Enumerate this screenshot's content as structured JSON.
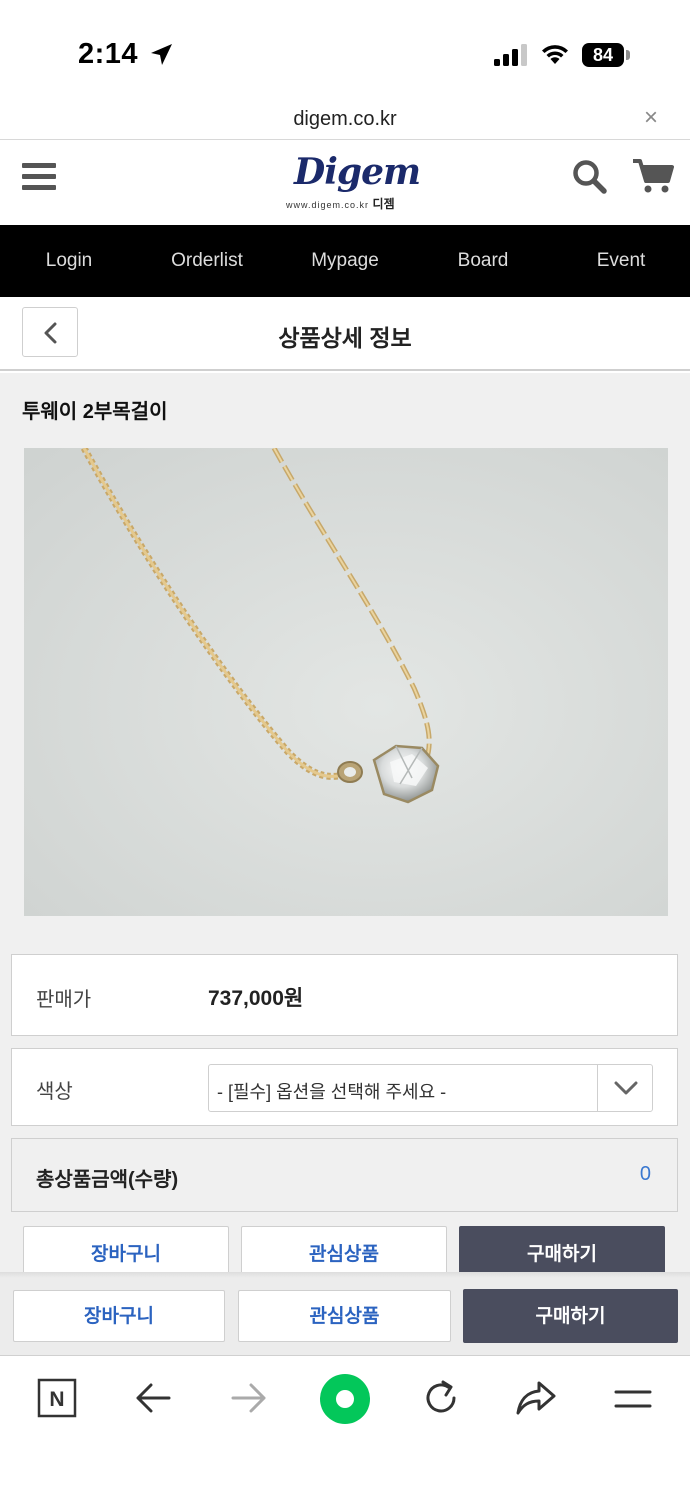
{
  "status_bar": {
    "time": "2:14",
    "battery": "84"
  },
  "url_bar": {
    "url": "digem.co.kr",
    "close_glyph": "×"
  },
  "header": {
    "logo_word": "Digem",
    "logo_url": "www.digem.co.kr",
    "logo_korean": "디젬"
  },
  "nav": {
    "items": [
      "Login",
      "Orderlist",
      "Mypage",
      "Board",
      "Event"
    ]
  },
  "page": {
    "title": "상품상세 정보"
  },
  "product": {
    "name": "투웨이 2부목걸이",
    "price_label": "판매가",
    "price_value": "737,000원",
    "option_label": "색상",
    "option_placeholder": "- [필수] 옵션을 선택해 주세요 -",
    "total_label": "총상품금액(수량)",
    "total_value": "0"
  },
  "actions": {
    "cart": "장바구니",
    "wishlist": "관심상품",
    "buy": "구매하기"
  },
  "colors": {
    "nav_bg": "#000000",
    "accent_blue": "#2b63c0",
    "buy_button": "#4a4d5e",
    "browser_green": "#03c75a"
  },
  "browser_toolbar": {
    "icons": [
      "naver-n-icon",
      "back-arrow-icon",
      "forward-arrow-icon",
      "green-dot-icon",
      "refresh-icon",
      "share-icon",
      "menu-icon"
    ],
    "n_glyph": "N"
  }
}
